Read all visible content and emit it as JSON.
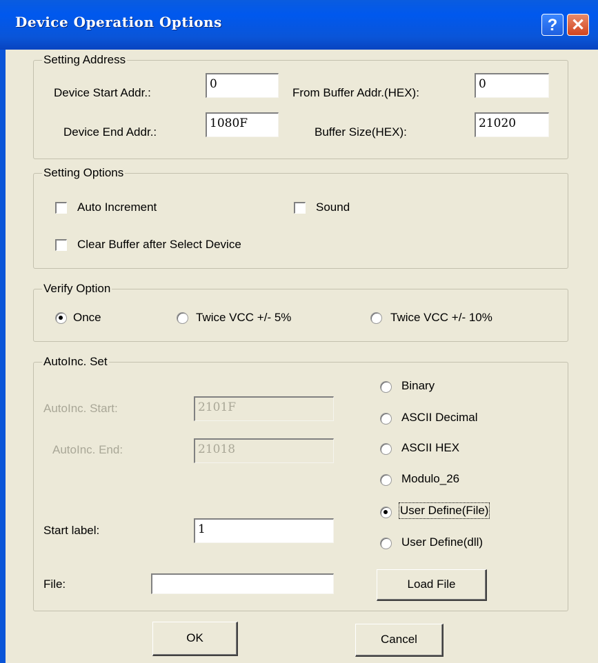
{
  "dialog": {
    "title": "Device Operation Options",
    "help_glyph": "?",
    "close_glyph": "✕"
  },
  "setting_address": {
    "legend": "Setting Address",
    "device_start_label": "Device Start Addr.:",
    "device_start_value": "0",
    "from_buffer_label": "From Buffer Addr.(HEX):",
    "from_buffer_value": "0",
    "device_end_label": "Device End Addr.:",
    "device_end_value": "1080F",
    "buffer_size_label": "Buffer Size(HEX):",
    "buffer_size_value": "21020"
  },
  "setting_options": {
    "legend": "Setting Options",
    "auto_increment": "Auto Increment",
    "sound": "Sound",
    "clear_buffer": "Clear Buffer after Select Device"
  },
  "verify_option": {
    "legend": "Verify Option",
    "once": "Once",
    "twice5": "Twice VCC +/- 5%",
    "twice10": "Twice VCC +/- 10%",
    "selected": "Once"
  },
  "autoinc": {
    "legend": "AutoInc. Set",
    "start_label": "AutoInc. Start:",
    "start_value": "2101F",
    "end_label": "AutoInc. End:",
    "end_value": "21018",
    "start_label_label": "Start label:",
    "start_label_value": "1",
    "file_label": "File:",
    "file_value": "",
    "load_file": "Load File",
    "modes": [
      "Binary",
      "ASCII Decimal",
      "ASCII HEX",
      "Modulo_26",
      "User Define(File)",
      "User Define(dll)"
    ],
    "selected_mode": "User Define(File)"
  },
  "buttons": {
    "ok": "OK",
    "cancel": "Cancel"
  }
}
